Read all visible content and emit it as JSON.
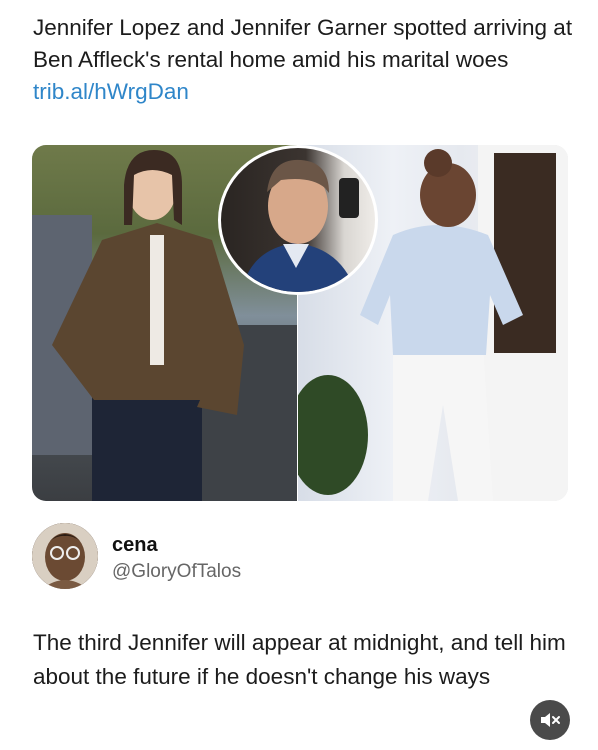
{
  "headline": {
    "text": "Jennifer Lopez and Jennifer Garner spotted arriving at Ben Affleck's rental home amid his marital woes ",
    "link": "trib.al/hWrgDan"
  },
  "colors": {
    "link": "#2f86c9",
    "text": "#1c1c1c",
    "handle": "#666666",
    "mute_button": "#4a4a4a"
  },
  "author": {
    "name": "cena",
    "handle": "@GloryOfTalos"
  },
  "post": {
    "text": "The third Jennifer will appear at midnight, and tell him about the future if he doesn't change his ways"
  },
  "icons": {
    "mute": "speaker-muted-icon"
  }
}
